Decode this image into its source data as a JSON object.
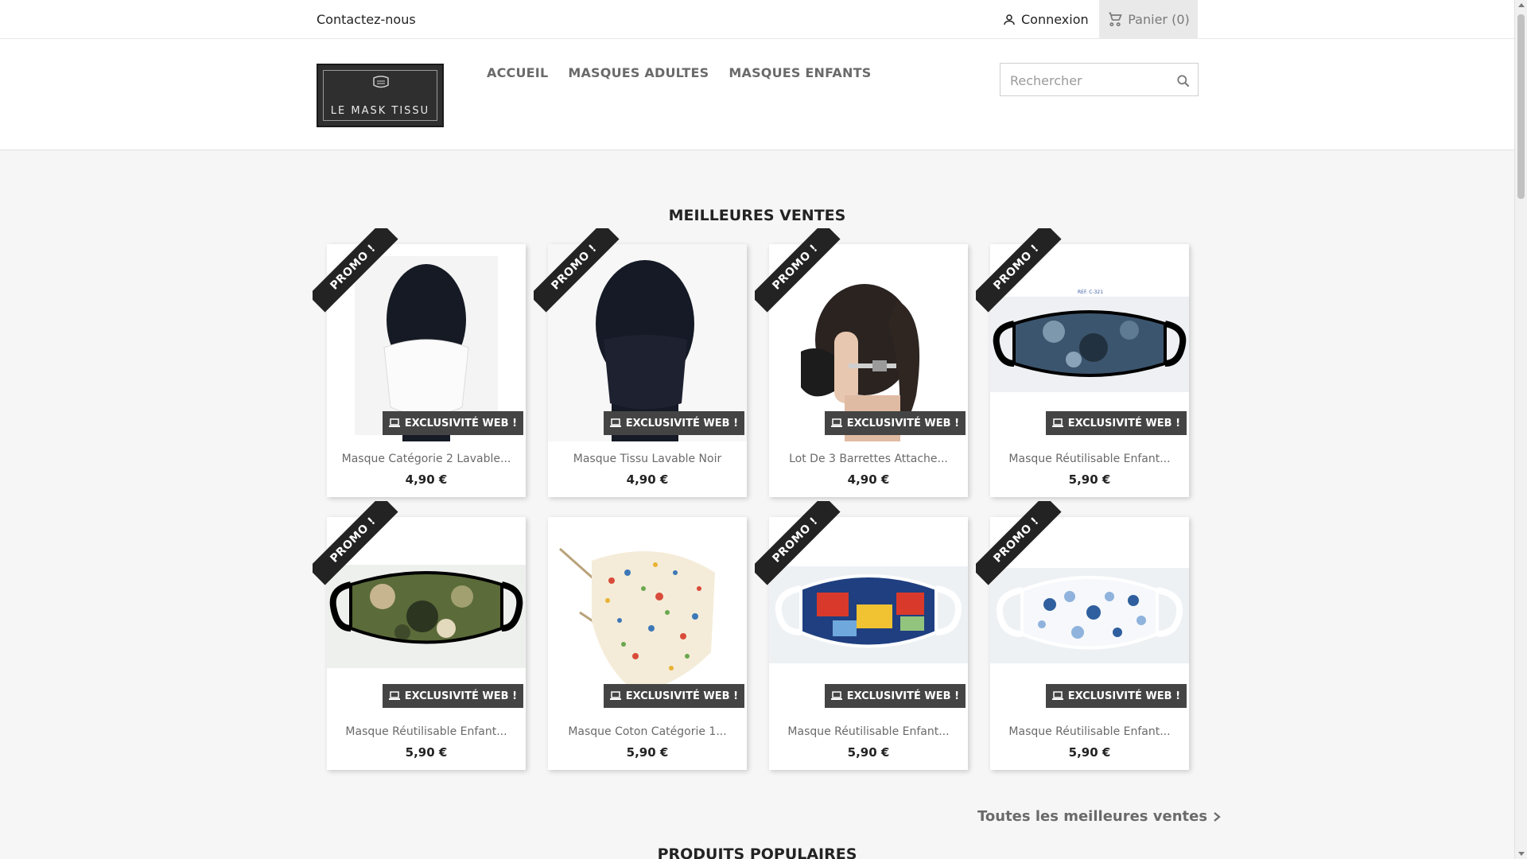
{
  "topnav": {
    "contact": "Contactez-nous",
    "signin": "Connexion",
    "cart": "Panier (0)"
  },
  "header": {
    "logo_text": "LE MASK TISSU",
    "menu": [
      "ACCUEIL",
      "MASQUES ADULTES",
      "MASQUES ENFANTS"
    ],
    "search_placeholder": "Rechercher"
  },
  "bestsellers": {
    "title": "MEILLEURES VENTES",
    "all_link": "Toutes les meilleures ventes",
    "products": [
      {
        "name": "Masque Catégorie 2 Lavable...",
        "price": "4,90 €",
        "promo": "PROMO !",
        "badge": "EXCLUSIVITÉ WEB !",
        "image": "white-mask-on-black-head"
      },
      {
        "name": "Masque Tissu Lavable Noir",
        "price": "4,90 €",
        "promo": "PROMO !",
        "badge": "EXCLUSIVITÉ WEB !",
        "image": "black-mask-on-black-head"
      },
      {
        "name": "Lot De 3 Barrettes Attache...",
        "price": "4,90 €",
        "promo": "PROMO !",
        "badge": "EXCLUSIVITÉ WEB !",
        "image": "woman-ponytail-mask-clip"
      },
      {
        "name": "Masque Réutilisable Enfant...",
        "price": "5,90 €",
        "promo": "PROMO !",
        "badge": "EXCLUSIVITÉ WEB !",
        "image": "blue-camo-mask",
        "image_caption": "REF. C-321"
      },
      {
        "name": "Masque Réutilisable Enfant...",
        "price": "5,90 €",
        "promo": "PROMO !",
        "badge": "EXCLUSIVITÉ WEB !",
        "image": "green-camo-mask"
      },
      {
        "name": "Masque Coton Catégorie 1...",
        "price": "5,90 €",
        "promo": "",
        "badge": "EXCLUSIVITÉ WEB !",
        "image": "floral-cotton-mask"
      },
      {
        "name": "Masque Réutilisable Enfant...",
        "price": "5,90 €",
        "promo": "PROMO !",
        "badge": "EXCLUSIVITÉ WEB !",
        "image": "comic-pop-mask"
      },
      {
        "name": "Masque Réutilisable Enfant...",
        "price": "5,90 €",
        "promo": "PROMO !",
        "badge": "EXCLUSIVITÉ WEB !",
        "image": "blue-leaves-mask"
      }
    ]
  },
  "popular": {
    "title": "PRODUITS POPULAIRES"
  },
  "colors": {
    "promo_bg": "#232323",
    "badge_bg": "#444444",
    "page_bg": "#f6f6f6"
  }
}
